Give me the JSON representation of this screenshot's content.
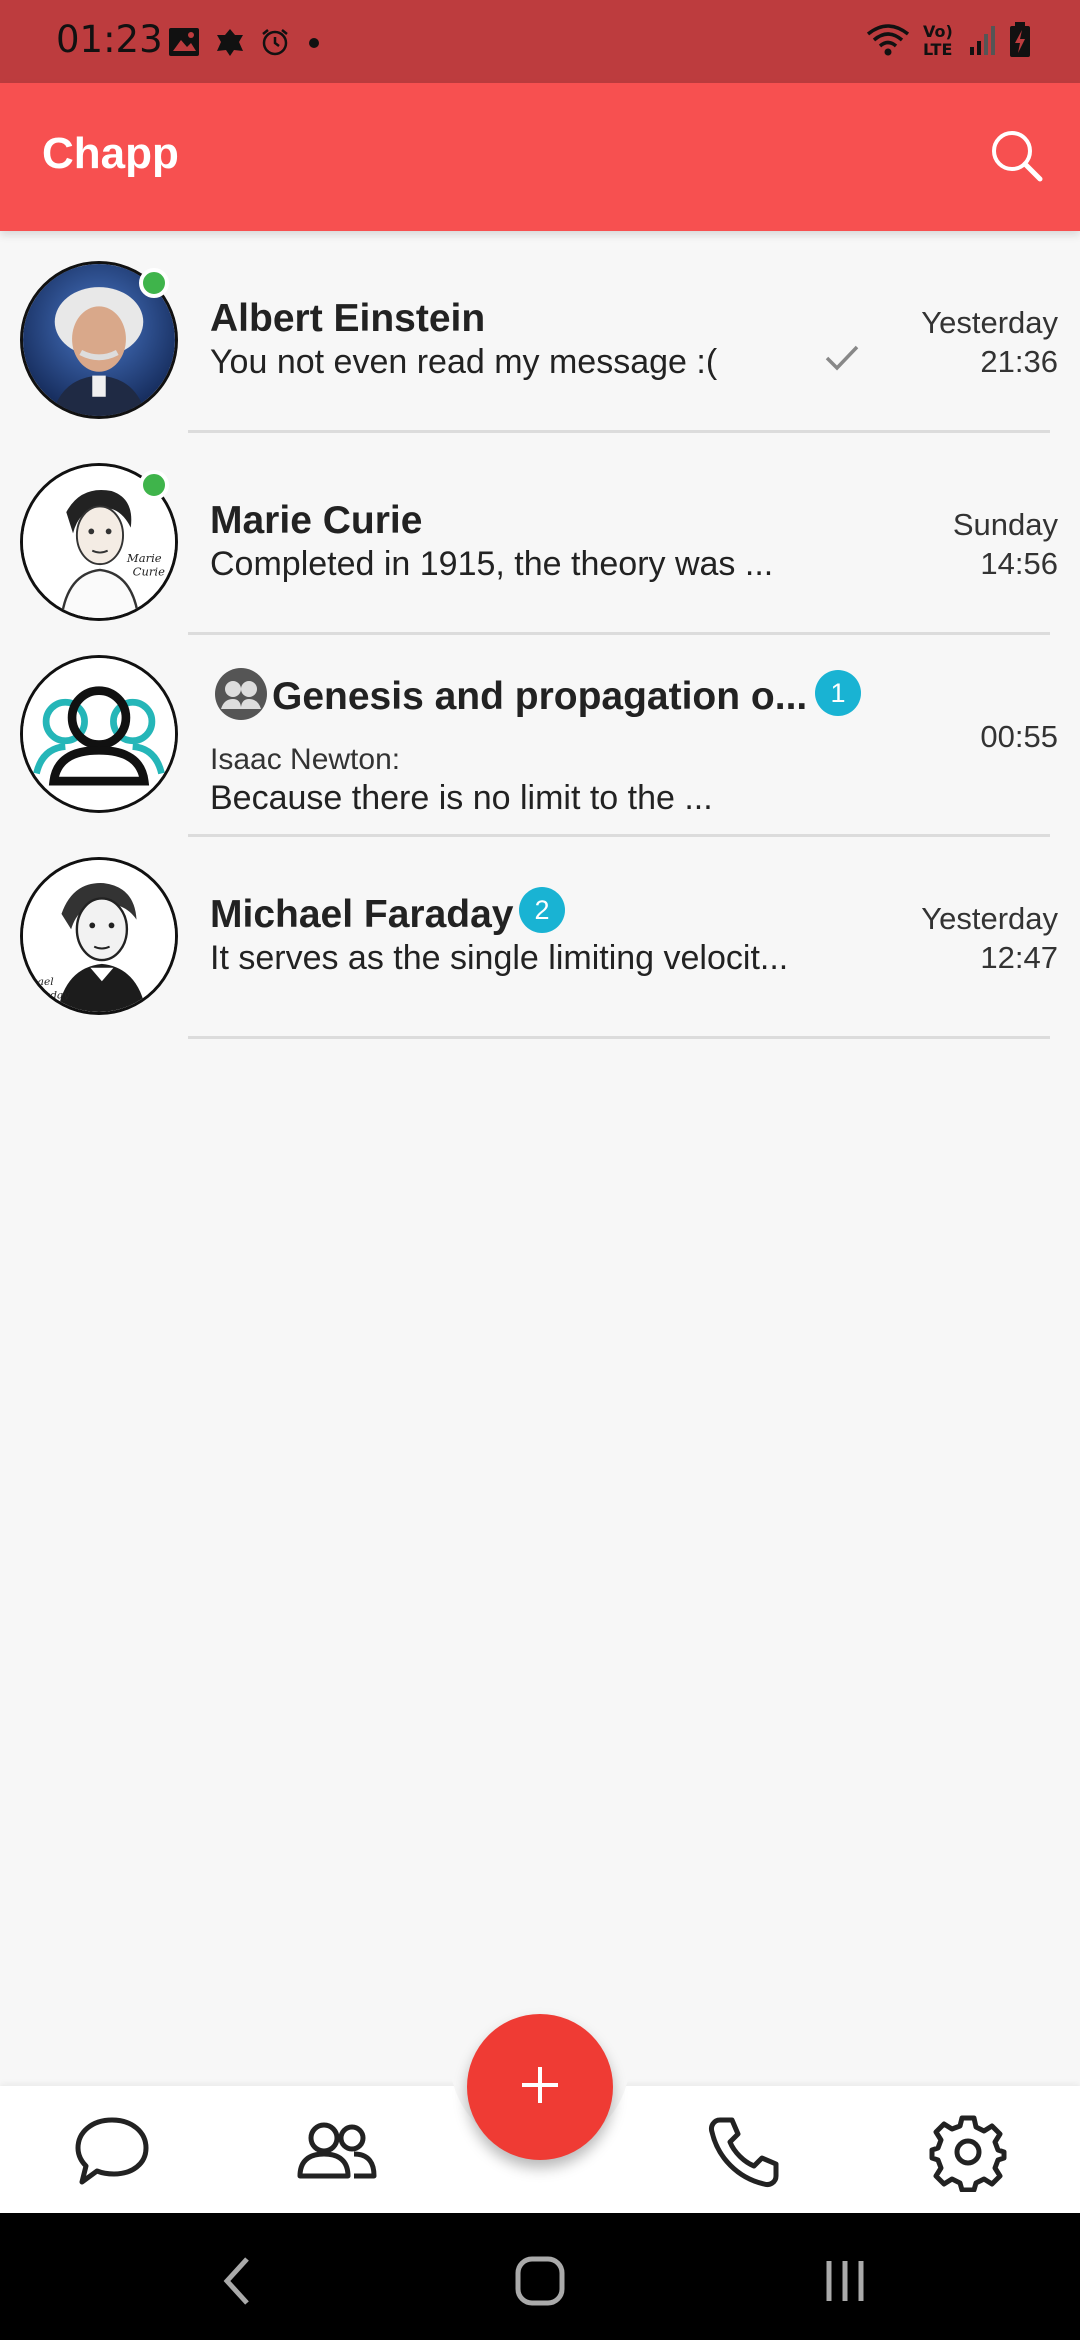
{
  "status_bar": {
    "time": "01:23",
    "icons_left": [
      "image-icon",
      "app-notification-icon",
      "alarm-icon",
      "dot-icon"
    ],
    "icons_right": [
      "wifi-icon",
      "volte-icon",
      "signal-icon",
      "battery-charging-icon"
    ],
    "volte_label": "Vo)\nLTE"
  },
  "app_bar": {
    "title": "Chapp",
    "search_icon": "search-icon"
  },
  "chats": [
    {
      "name": "Albert Einstein",
      "preview": "You not even read my message :(",
      "date": "Yesterday",
      "time": "21:36",
      "online": true,
      "sent_check": true,
      "avatar": "einstein-avatar"
    },
    {
      "name": "Marie Curie",
      "preview": "Completed in 1915, the theory was ...",
      "date": "Sunday",
      "time": "14:56",
      "online": true,
      "avatar": "curie-avatar"
    },
    {
      "name": "Genesis and propagation o...",
      "sender": "Isaac Newton:",
      "preview": "Because there is no limit to the ...",
      "date": "",
      "time": "00:55",
      "unread": "1",
      "is_group": true,
      "avatar": "group-avatar"
    },
    {
      "name": "Michael Faraday",
      "preview": "It serves as the single limiting velocit...",
      "date": "Yesterday",
      "time": "12:47",
      "unread": "2",
      "avatar": "faraday-avatar"
    }
  ],
  "bottom_nav": {
    "items": [
      "chats-icon",
      "contacts-icon",
      "calls-icon",
      "settings-icon"
    ],
    "fab_icon": "plus-icon"
  },
  "system_nav": [
    "back-icon",
    "home-icon",
    "recents-icon"
  ],
  "colors": {
    "status_bar": "#bd3c3e",
    "app_bar": "#f75050",
    "fab": "#ef3b34",
    "badge": "#19b3d3",
    "online": "#3fb44b"
  }
}
